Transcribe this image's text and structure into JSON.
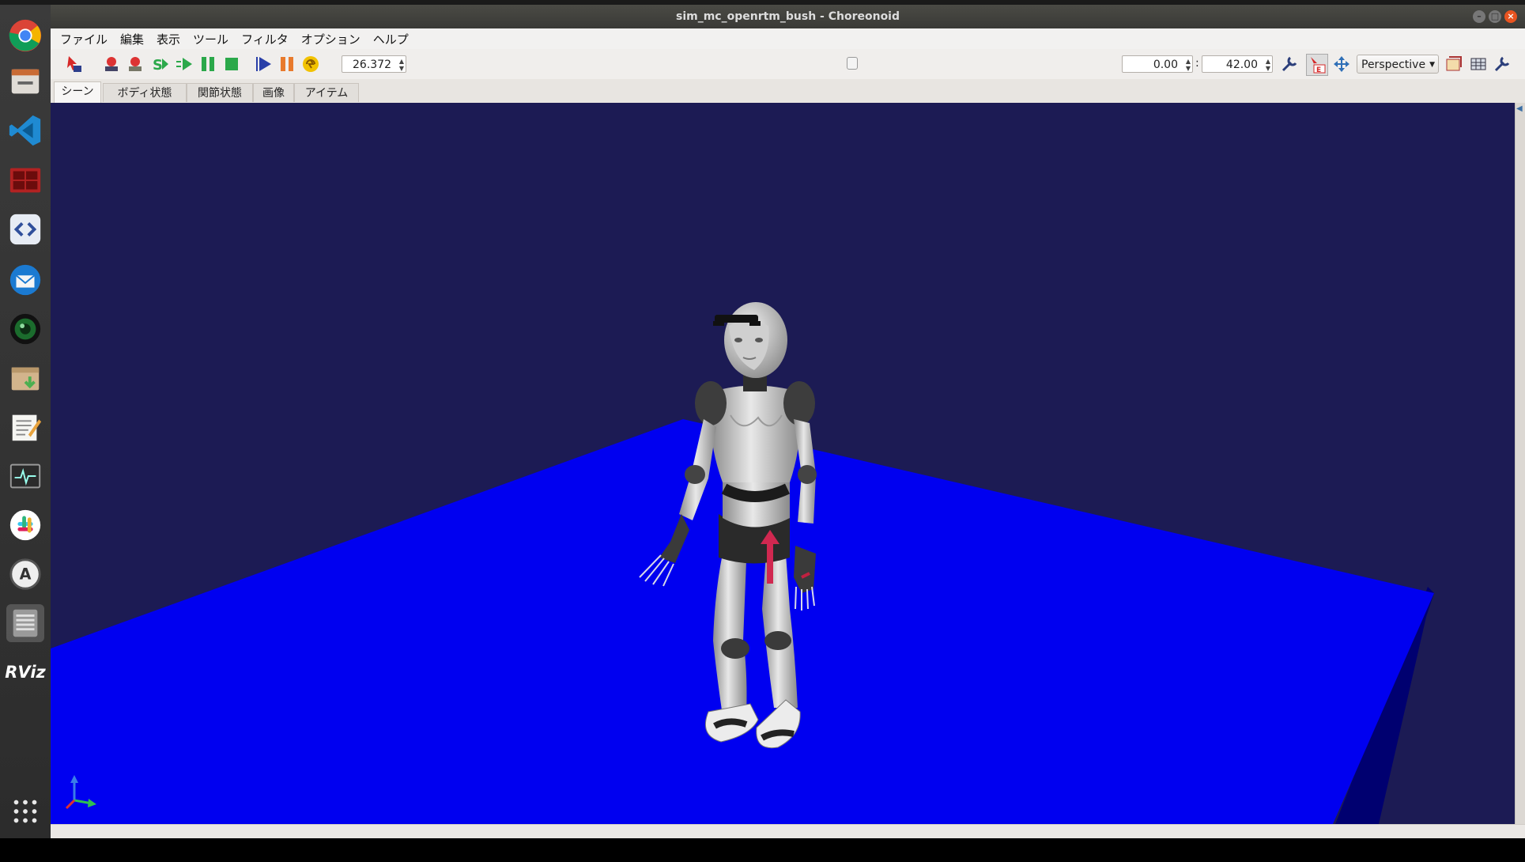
{
  "window": {
    "title": "sim_mc_openrtm_bush - Choreonoid"
  },
  "menubar": {
    "items": [
      "ファイル",
      "編集",
      "表示",
      "ツール",
      "フィルタ",
      "オプション",
      "ヘルプ"
    ]
  },
  "toolbar": {
    "time_value": "26.372",
    "time_slider_fraction": 0.6279,
    "range_start": "0.00",
    "range_separator": ":",
    "range_end": "42.00",
    "view_mode": "Perspective"
  },
  "tabs": [
    "シーン",
    "ボディ状態",
    "関節状態",
    "画像",
    "アイテム"
  ],
  "launcher": {
    "icons": [
      "chrome-icon",
      "file-manager-icon",
      "vscode-icon",
      "terminal-icon",
      "code-editor-icon",
      "thunderbird-icon",
      "camera-icon",
      "archive-manager-icon",
      "text-editor-icon",
      "system-monitor-icon",
      "slack-icon",
      "software-updater-icon",
      "choreonoid-icon",
      "rviz-icon",
      "show-apps-icon"
    ],
    "rviz_label": "RViz"
  },
  "colors": {
    "scene_bg": "#1c1b54",
    "floor": "#0000f0",
    "floor_side": "#000070",
    "slider": "#3b94d9"
  }
}
